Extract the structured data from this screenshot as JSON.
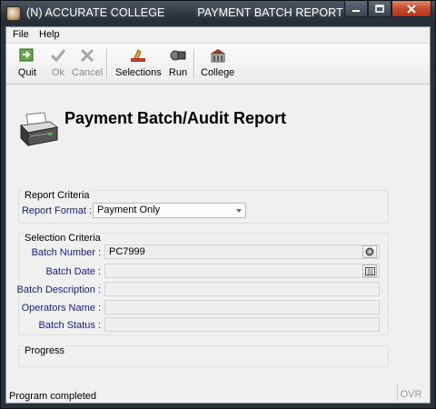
{
  "window": {
    "title": "(N) ACCURATE COLLEGE          PAYMENT BATCH REPORT"
  },
  "menu": {
    "items": [
      "File",
      "Help"
    ]
  },
  "toolbar": {
    "buttons": [
      {
        "label": "Quit",
        "icon": "quit-icon",
        "enabled": true
      },
      {
        "label": "Ok",
        "icon": "checkmark-icon",
        "enabled": false
      },
      {
        "label": "Cancel",
        "icon": "cancel-x-icon",
        "enabled": false
      },
      {
        "label": "Selections",
        "icon": "selections-icon",
        "enabled": true
      },
      {
        "label": "Run",
        "icon": "run-icon",
        "enabled": true
      },
      {
        "label": "College",
        "icon": "college-icon",
        "enabled": true
      }
    ]
  },
  "header": {
    "title": "Payment Batch/Audit Report",
    "icon": "printer-icon"
  },
  "report_criteria": {
    "title": "Report Criteria",
    "format_label": "Report Format :",
    "format_value": "Payment Only"
  },
  "selection_criteria": {
    "title": "Selection Criteria",
    "fields": [
      {
        "label": "Batch Number :",
        "value": "PC7999"
      },
      {
        "label": "Batch Date :",
        "value": ""
      },
      {
        "label": "Batch Description :",
        "value": ""
      },
      {
        "label": "Operators Name :",
        "value": ""
      },
      {
        "label": "Batch Status :",
        "value": ""
      }
    ]
  },
  "progress": {
    "title": "Progress"
  },
  "status": {
    "text": "Program completed",
    "ovr": "OVR"
  }
}
